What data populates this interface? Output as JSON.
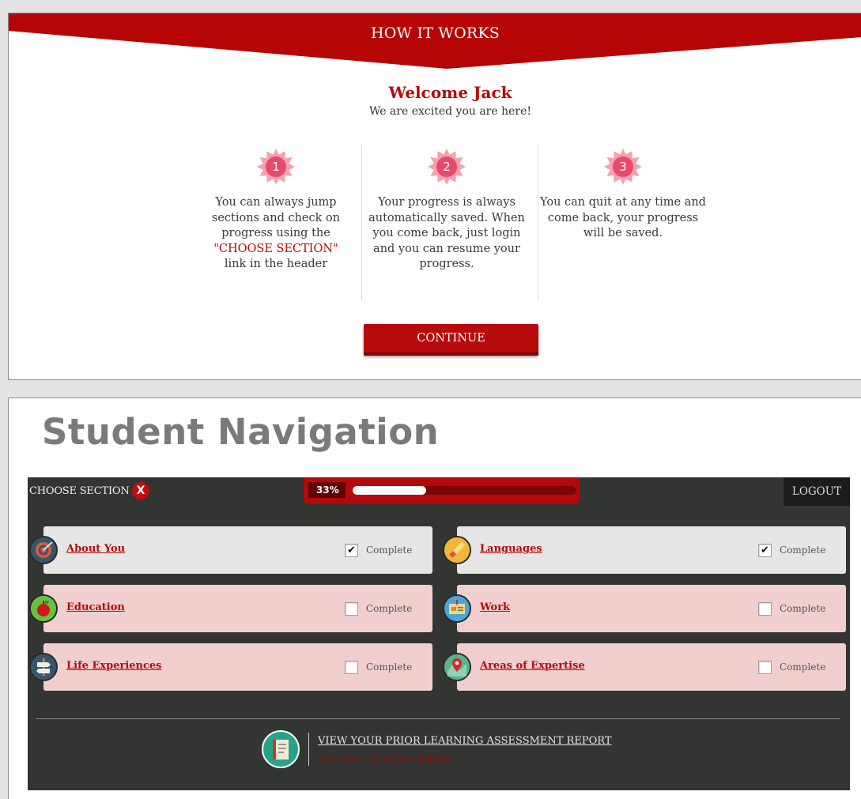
{
  "how_it_works": {
    "title": "HOW IT WORKS",
    "welcome": "Welcome Jack",
    "subtitle": "We are excited you are here!",
    "steps": [
      {
        "number": "1",
        "text": "You can always jump sections and check on progress using the",
        "accent": "\"CHOOSE SECTION\"",
        "text_after": "link in the header"
      },
      {
        "number": "2",
        "text": "Your progress is always automatically saved. When you come back, just login and you can resume your progress."
      },
      {
        "number": "3",
        "text": "You can quit at any time and come back, your progress will be saved."
      }
    ],
    "continue_label": "CONTINUE"
  },
  "student_navigation": {
    "heading": "Student Navigation",
    "topbar": {
      "choose_section": "CHOOSE SECTION",
      "close_symbol": "X",
      "progress_label": "33%",
      "progress_value": 0.33,
      "logout": "LOGOUT"
    },
    "sections": [
      {
        "label": "About You",
        "icon": "target-icon",
        "complete_label": "Complete",
        "checked": "✔",
        "state": "done"
      },
      {
        "label": "Languages",
        "icon": "brush-icon",
        "complete_label": "Complete",
        "checked": "✔",
        "state": "done"
      },
      {
        "label": "Education",
        "icon": "apple-icon",
        "complete_label": "Complete",
        "checked": "",
        "state": "todo"
      },
      {
        "label": "Work",
        "icon": "id-card-icon",
        "complete_label": "Complete",
        "checked": "",
        "state": "todo"
      },
      {
        "label": "Life Experiences",
        "icon": "signpost-icon",
        "complete_label": "Complete",
        "checked": "",
        "state": "todo"
      },
      {
        "label": "Areas of Expertise",
        "icon": "map-pin-icon",
        "complete_label": "Complete",
        "checked": "",
        "state": "todo"
      }
    ],
    "report": {
      "link": "VIEW YOUR PRIOR LEARNING ASSESSMENT REPORT",
      "status": "Your report is not yet complete",
      "icon": "book-icon"
    }
  },
  "colors": {
    "brand_red": "#b70a0b",
    "dark_panel": "#333533",
    "card_done": "#e6e6e6",
    "card_todo": "#f2cfcf",
    "badge_pink": "#e84a6c"
  }
}
